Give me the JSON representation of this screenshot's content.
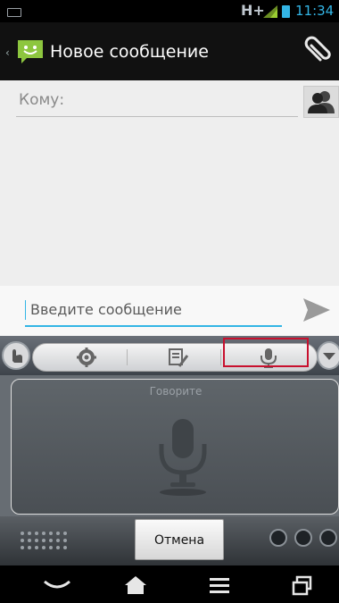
{
  "status_bar": {
    "network": "H+",
    "time": "11:34",
    "accent_color": "#33b5e5"
  },
  "action_bar": {
    "title": "Новое сообщение",
    "app_icon": "messaging-smiley-icon",
    "attach_icon": "paperclip-icon"
  },
  "compose": {
    "to_label": "Кому:",
    "message_placeholder": "Введите сообщение",
    "send_icon": "send-icon",
    "contacts_icon": "contacts-icon"
  },
  "ime_toolbar": {
    "items": [
      "settings-gear-icon",
      "edit-note-icon",
      "microphone-icon"
    ],
    "selected": "microphone-icon"
  },
  "voice_input": {
    "prompt": "Говорите",
    "cancel_label": "Отмена"
  },
  "nav_bar": {
    "items": [
      "back-icon",
      "home-icon",
      "menu-icon",
      "recent-apps-icon"
    ]
  }
}
